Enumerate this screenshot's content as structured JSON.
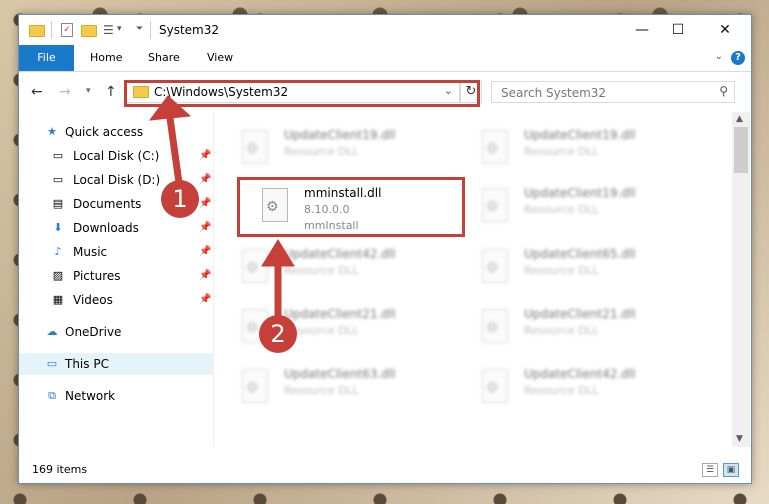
{
  "window": {
    "title": "System32",
    "controls": {
      "minimize": "—",
      "maximize": "☐",
      "close": "✕"
    }
  },
  "ribbon": {
    "tabs": [
      "File",
      "Home",
      "Share",
      "View"
    ],
    "help": "?"
  },
  "nav": {
    "address": "C:\\Windows\\System32",
    "search_placeholder": "Search System32"
  },
  "sidebar": {
    "items": [
      {
        "label": "Quick access",
        "icon": "star-icon"
      },
      {
        "label": "Local Disk (C:)",
        "icon": "drive-icon",
        "pinned": true
      },
      {
        "label": "Local Disk (D:)",
        "icon": "drive-icon",
        "pinned": true
      },
      {
        "label": "Documents",
        "icon": "documents-icon",
        "pinned": true
      },
      {
        "label": "Downloads",
        "icon": "download-icon",
        "pinned": true
      },
      {
        "label": "Music",
        "icon": "music-icon",
        "pinned": true
      },
      {
        "label": "Pictures",
        "icon": "pictures-icon",
        "pinned": true
      },
      {
        "label": "Videos",
        "icon": "videos-icon",
        "pinned": true
      },
      {
        "label": "OneDrive",
        "icon": "cloud-icon"
      },
      {
        "label": "This PC",
        "icon": "computer-icon",
        "selected": true
      },
      {
        "label": "Network",
        "icon": "network-icon"
      }
    ]
  },
  "files": {
    "highlighted": {
      "name": "mminstall.dll",
      "version": "8.10.0.0",
      "description": "mmInstall"
    },
    "background": [
      {
        "name": "UpdateClient19.dll",
        "type": "Resource DLL"
      },
      {
        "name": "UpdateClient19.dll",
        "type": "Resource DLL"
      },
      {
        "name": "UpdateClient19.dll",
        "type": "Resource DLL"
      },
      {
        "name": "UpdateClient42.dll",
        "type": "Resource DLL"
      },
      {
        "name": "UpdateClient65.dll",
        "type": "Resource DLL"
      },
      {
        "name": "UpdateClient21.dll",
        "type": "Resource DLL"
      },
      {
        "name": "UpdateClient21.dll",
        "type": "Resource DLL"
      },
      {
        "name": "UpdateClient63.dll",
        "type": "Resource DLL"
      },
      {
        "name": "UpdateClient42.dll",
        "type": "Resource DLL"
      }
    ]
  },
  "status": {
    "item_count": "169 items"
  },
  "annotations": {
    "badge1": "1",
    "badge2": "2",
    "color": "#c6403a"
  }
}
